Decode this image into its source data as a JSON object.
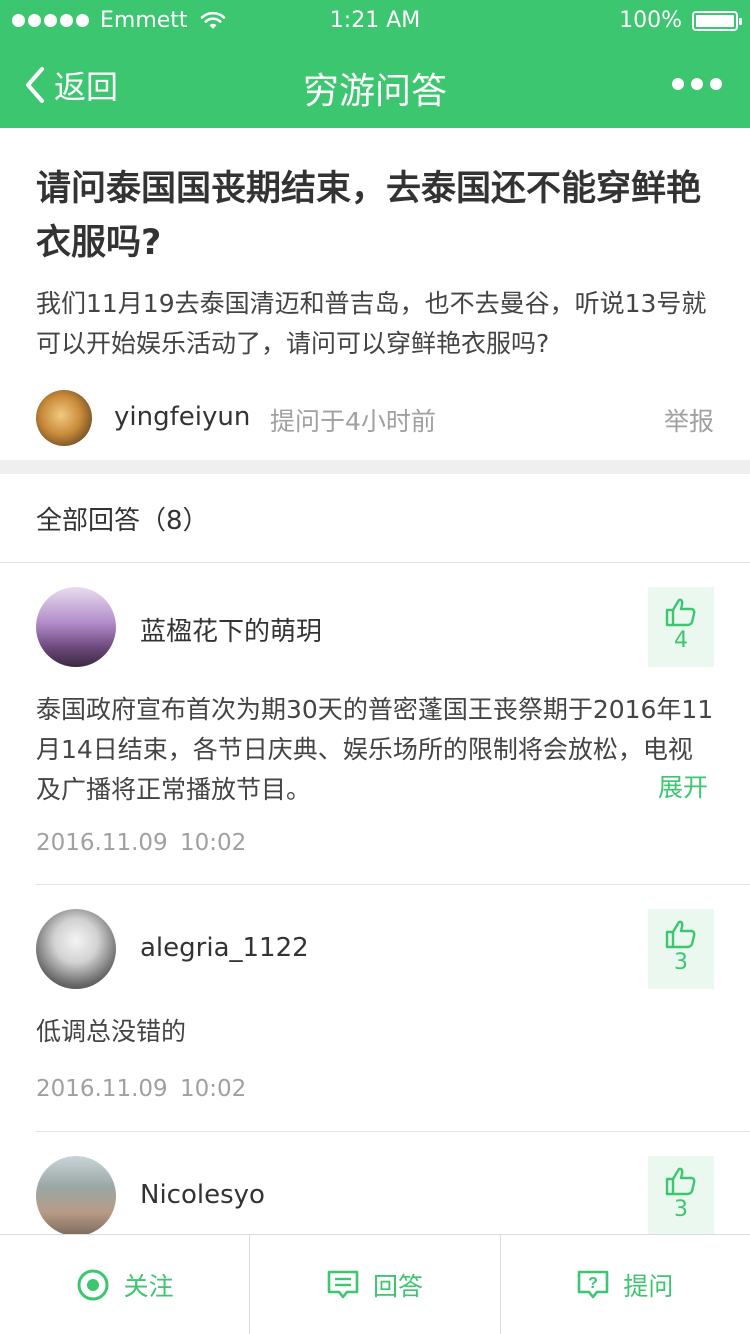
{
  "status_bar": {
    "carrier": "Emmett",
    "time": "1:21 AM",
    "battery": "100%"
  },
  "nav": {
    "back_label": "返回",
    "title": "穷游问答"
  },
  "question": {
    "title": "请问泰国国丧期结束，去泰国还不能穿鲜艳衣服吗?",
    "body": "我们11月19去泰国清迈和普吉岛，也不去曼谷，听说13号就可以开始娱乐活动了，请问可以穿鲜艳衣服吗?",
    "user": "yingfeiyun",
    "time": "提问于4小时前",
    "report": "举报"
  },
  "answers_header": "全部回答（8）",
  "answers": [
    {
      "user": "蓝楹花下的萌玥",
      "likes": "4",
      "content": "泰国政府宣布首次为期30天的普密蓬国王丧祭期于2016年11月14日结束，各节日庆典、娱乐场所的限制将会放松，电视及广播将正常播放节目。",
      "expand": "展开",
      "date": "2016.11.09",
      "time": "10:02"
    },
    {
      "user": "alegria_1122",
      "likes": "3",
      "content": "低调总没错的",
      "date": "2016.11.09",
      "time": "10:02"
    },
    {
      "user": "Nicolesyo",
      "likes": "3"
    }
  ],
  "tabbar": {
    "follow": "关注",
    "answer": "回答",
    "ask": "提问"
  },
  "colors": {
    "accent": "#3cc66f",
    "divider": "#efefef"
  }
}
